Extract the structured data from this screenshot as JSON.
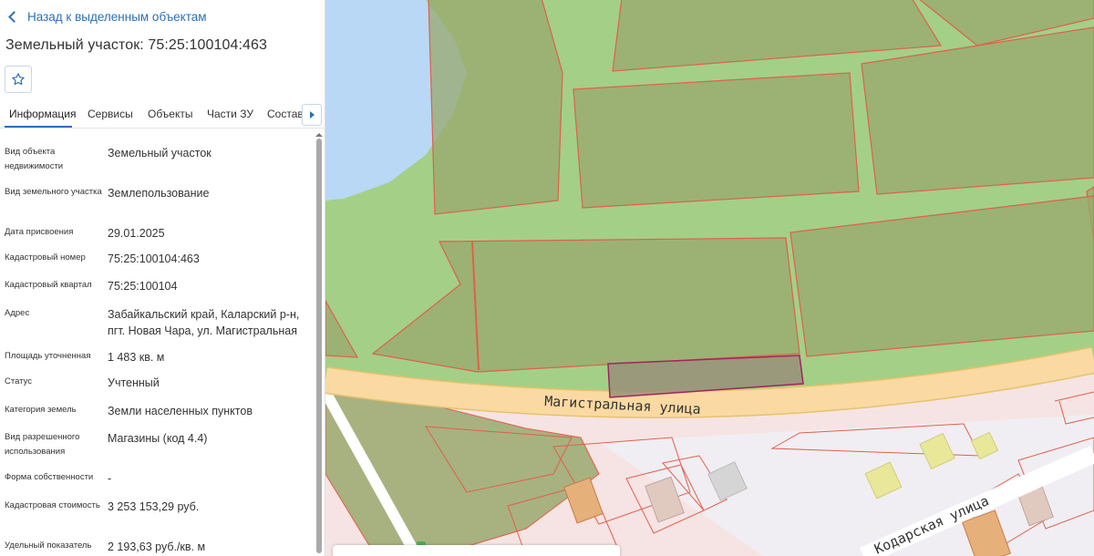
{
  "panel": {
    "back_label": "Назад к выделенным объектам",
    "title": "Земельный участок: 75:25:100104:463",
    "tabs": [
      {
        "label": "Информация"
      },
      {
        "label": "Сервисы"
      },
      {
        "label": "Объекты"
      },
      {
        "label": "Части ЗУ"
      },
      {
        "label": "Состав"
      }
    ],
    "properties": [
      {
        "label": "Вид объекта недвижимости",
        "value": "Земельный участок"
      },
      {
        "label": "Вид земельного участка",
        "value": "Землепользование"
      },
      {
        "label": "Дата присвоения",
        "value": "29.01.2025"
      },
      {
        "label": "Кадастровый номер",
        "value": "75:25:100104:463"
      },
      {
        "label": "Кадастровый квартал",
        "value": "75:25:100104"
      },
      {
        "label": "Адрес",
        "value": "Забайкальский край, Каларский р-н, пгт. Новая Чара, ул. Магистральная"
      },
      {
        "label": "Площадь уточненная",
        "value": "1 483 кв. м"
      },
      {
        "label": "Статус",
        "value": "Учтенный"
      },
      {
        "label": "Категория земель",
        "value": "Земли населенных пунктов"
      },
      {
        "label": "Вид разрешенного использования",
        "value": "Магазины (код 4.4)"
      },
      {
        "label": "Форма собственности",
        "value": "-"
      },
      {
        "label": "Кадастровая стоимость",
        "value": "3 253 153,29 руб."
      },
      {
        "label": "Удельный показатель",
        "value": "2 193,63 руб./кв. м"
      }
    ]
  },
  "map": {
    "street_main": "Магистральная улица",
    "street_second": "Кодарская улица",
    "colors": {
      "accent": "#2b6fb5",
      "grass": "#a3cf86",
      "parcel_fill": "#9aa86e",
      "parcel_border": "#e0604a",
      "water": "#b9d8f5",
      "road": "#fbd9a2",
      "residential": "#f6e4e4",
      "selected_parcel": "#a0255f"
    }
  }
}
